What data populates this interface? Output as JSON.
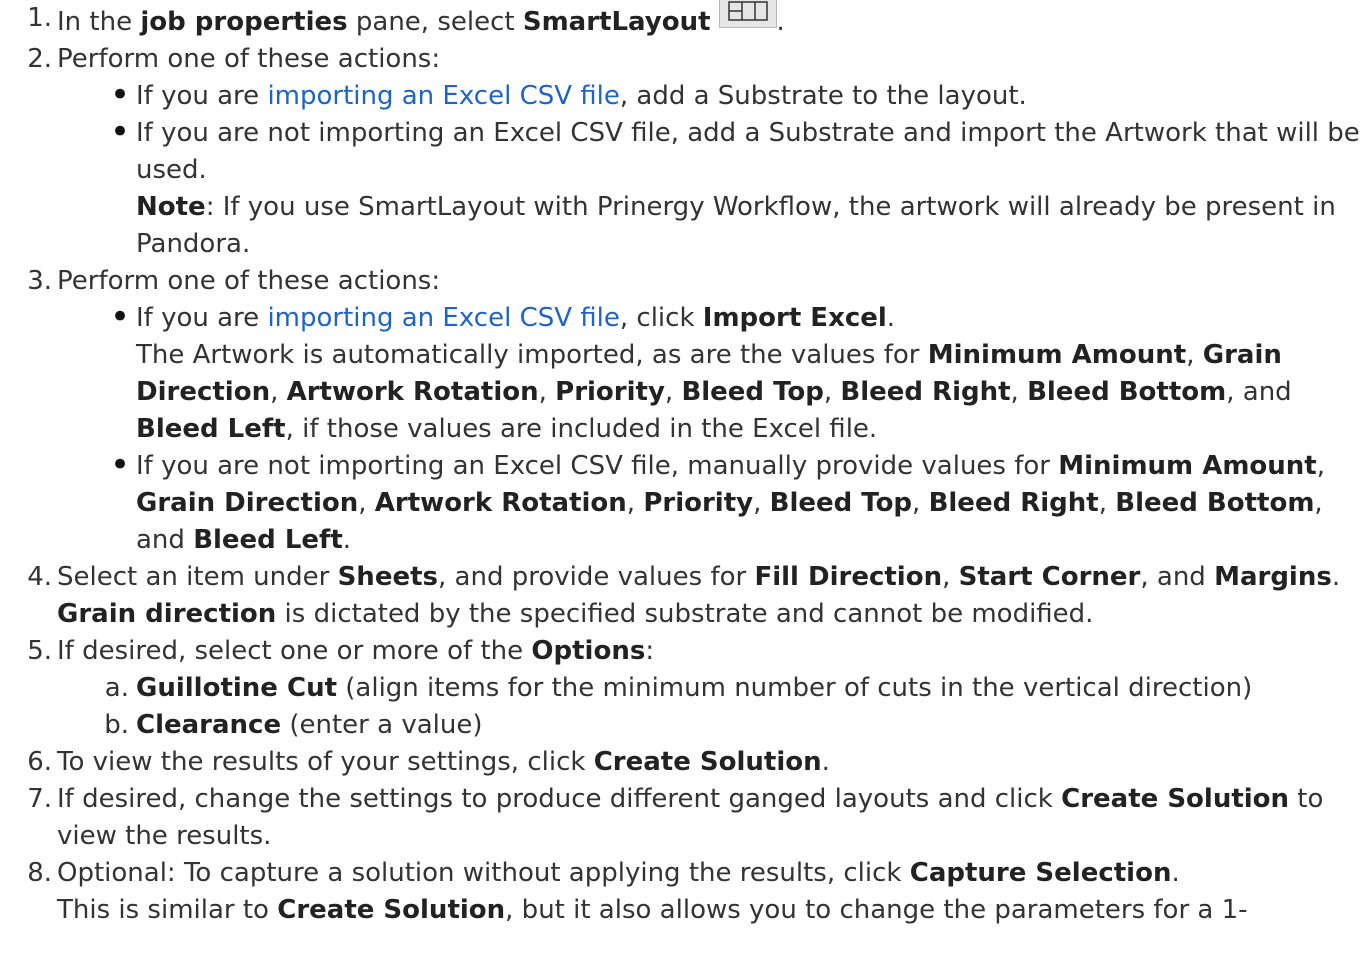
{
  "steps": [
    {
      "num": "1.",
      "parts": [
        [
          "t",
          "In the "
        ],
        [
          "b",
          "job properties"
        ],
        [
          "t",
          " pane, select "
        ],
        [
          "b",
          "SmartLayout"
        ],
        [
          "icon",
          "smartlayout-icon"
        ],
        [
          "t",
          "."
        ]
      ]
    },
    {
      "num": "2.",
      "parts": [
        [
          "t",
          "Perform one of these actions:"
        ]
      ],
      "bullets": [
        {
          "parts": [
            [
              "t",
              "If you are "
            ],
            [
              "a",
              "importing an Excel CSV file"
            ],
            [
              "t",
              ", add a Substrate to the layout."
            ]
          ]
        },
        {
          "parts": [
            [
              "t",
              "If you are not importing an Excel CSV file, add a Substrate and import the Artwork that will be used."
            ],
            [
              "br"
            ],
            [
              "b",
              "Note"
            ],
            [
              "t",
              ": If you use SmartLayout with Prinergy Workflow, the artwork will already be present in Pandora."
            ]
          ]
        }
      ]
    },
    {
      "num": "3.",
      "parts": [
        [
          "t",
          "Perform one of these actions:"
        ]
      ],
      "bullets": [
        {
          "parts": [
            [
              "t",
              "If you are "
            ],
            [
              "a",
              "importing an Excel CSV file"
            ],
            [
              "t",
              ", click "
            ],
            [
              "b",
              "Import Excel"
            ],
            [
              "t",
              "."
            ],
            [
              "br"
            ],
            [
              "t",
              "The Artwork is automatically imported, as are the values for "
            ],
            [
              "b",
              "Minimum Amount"
            ],
            [
              "t",
              ", "
            ],
            [
              "b",
              "Grain Direction"
            ],
            [
              "t",
              ", "
            ],
            [
              "b",
              "Artwork Rotation"
            ],
            [
              "t",
              ", "
            ],
            [
              "b",
              "Priority"
            ],
            [
              "t",
              ", "
            ],
            [
              "b",
              "Bleed Top"
            ],
            [
              "t",
              ", "
            ],
            [
              "b",
              "Bleed Right"
            ],
            [
              "t",
              ", "
            ],
            [
              "b",
              "Bleed Bottom"
            ],
            [
              "t",
              ", and "
            ],
            [
              "b",
              "Bleed Left"
            ],
            [
              "t",
              ", if those values are included in the Excel file."
            ]
          ]
        },
        {
          "parts": [
            [
              "t",
              "If you are not importing an Excel CSV file, manually provide values for "
            ],
            [
              "b",
              "Minimum Amount"
            ],
            [
              "t",
              ", "
            ],
            [
              "b",
              "Grain Direction"
            ],
            [
              "t",
              ", "
            ],
            [
              "b",
              "Artwork Rotation"
            ],
            [
              "t",
              ", "
            ],
            [
              "b",
              "Priority"
            ],
            [
              "t",
              ", "
            ],
            [
              "b",
              "Bleed Top"
            ],
            [
              "t",
              ", "
            ],
            [
              "b",
              "Bleed Right"
            ],
            [
              "t",
              ", "
            ],
            [
              "b",
              "Bleed Bottom"
            ],
            [
              "t",
              ", and "
            ],
            [
              "b",
              "Bleed Left"
            ],
            [
              "t",
              "."
            ]
          ]
        }
      ]
    },
    {
      "num": "4.",
      "parts": [
        [
          "t",
          "Select an item under "
        ],
        [
          "b",
          "Sheets"
        ],
        [
          "t",
          ", and provide values for "
        ],
        [
          "b",
          "Fill Direction"
        ],
        [
          "t",
          ", "
        ],
        [
          "b",
          "Start Corner"
        ],
        [
          "t",
          ", and "
        ],
        [
          "b",
          "Margins"
        ],
        [
          "t",
          "."
        ],
        [
          "br"
        ],
        [
          "b",
          "Grain direction"
        ],
        [
          "t",
          " is dictated by the specified substrate and cannot be modified."
        ]
      ]
    },
    {
      "num": "5.",
      "parts": [
        [
          "t",
          "If desired, select one or more of the "
        ],
        [
          "b",
          "Options"
        ],
        [
          "t",
          ":"
        ]
      ],
      "alpha": [
        {
          "num": "a.",
          "parts": [
            [
              "b",
              "Guillotine Cut"
            ],
            [
              "t",
              " (align items for the minimum number of cuts in the vertical direction)"
            ]
          ]
        },
        {
          "num": "b.",
          "parts": [
            [
              "b",
              "Clearance"
            ],
            [
              "t",
              " (enter a value)"
            ]
          ]
        }
      ]
    },
    {
      "num": "6.",
      "parts": [
        [
          "t",
          "To view the results of your settings, click "
        ],
        [
          "b",
          "Create Solution"
        ],
        [
          "t",
          "."
        ]
      ]
    },
    {
      "num": "7.",
      "parts": [
        [
          "t",
          "If desired, change the settings to produce different ganged layouts and click "
        ],
        [
          "b",
          "Create Solution"
        ],
        [
          "t",
          " to view the results."
        ]
      ]
    },
    {
      "num": "8.",
      "parts": [
        [
          "t",
          "Optional: To capture a solution without applying the results, click "
        ],
        [
          "b",
          "Capture Selection"
        ],
        [
          "t",
          "."
        ],
        [
          "br"
        ],
        [
          "t",
          "This is similar to "
        ],
        [
          "b",
          "Create Solution"
        ],
        [
          "t",
          ", but it also allows you to change the parameters for a 1-"
        ]
      ]
    }
  ]
}
